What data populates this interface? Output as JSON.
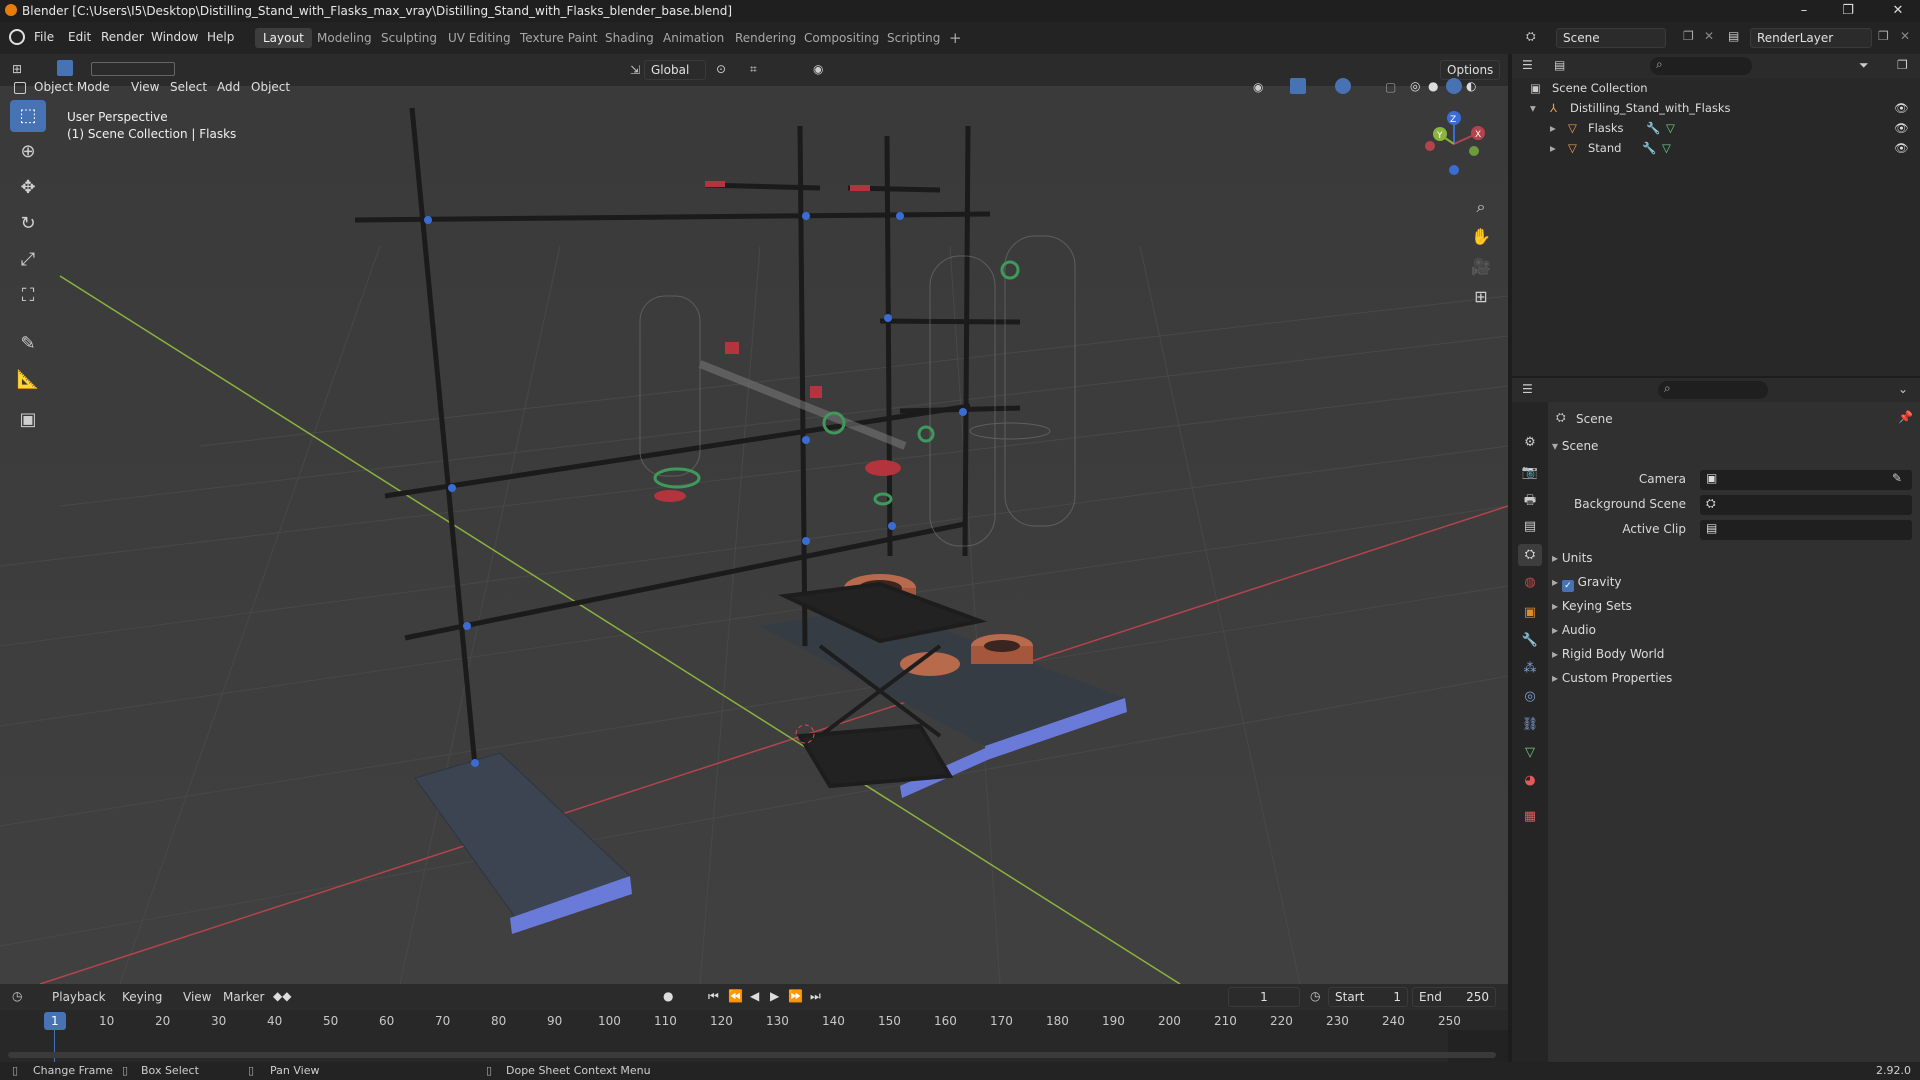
{
  "window": {
    "title": "Blender [C:\\Users\\I5\\Desktop\\Distilling_Stand_with_Flasks_max_vray\\Distilling_Stand_with_Flasks_blender_base.blend]",
    "minimize": "–",
    "maximize": "❐",
    "close": "✕"
  },
  "menus": [
    "File",
    "Edit",
    "Render",
    "Window",
    "Help"
  ],
  "workspaces": [
    {
      "label": "Layout",
      "active": true
    },
    {
      "label": "Modeling"
    },
    {
      "label": "Sculpting"
    },
    {
      "label": "UV Editing"
    },
    {
      "label": "Texture Paint"
    },
    {
      "label": "Shading"
    },
    {
      "label": "Animation"
    },
    {
      "label": "Rendering"
    },
    {
      "label": "Compositing"
    },
    {
      "label": "Scripting"
    }
  ],
  "add_workspace": "+",
  "scene_selector": {
    "value": "Scene"
  },
  "renderlayer_selector": {
    "value": "RenderLayer"
  },
  "viewport_header": {
    "mode": "Object Mode",
    "menus": [
      "View",
      "Select",
      "Add",
      "Object"
    ],
    "transform_orientation": "Global",
    "options": "Options"
  },
  "viewport_overlay": {
    "perspective": "User Perspective",
    "collection": "(1) Scene Collection | Flasks"
  },
  "gizmo": {
    "x": "X",
    "y": "Y",
    "z": "Z"
  },
  "outliner": {
    "root": "Scene Collection",
    "items": [
      {
        "label": "Distilling_Stand_with_Flasks"
      },
      {
        "label": "Flasks"
      },
      {
        "label": "Stand"
      }
    ]
  },
  "properties": {
    "context": "Scene",
    "section": "Scene",
    "camera_label": "Camera",
    "background_scene_label": "Background Scene",
    "active_clip_label": "Active Clip",
    "panels": [
      "Units",
      "Gravity",
      "Keying Sets",
      "Audio",
      "Rigid Body World",
      "Custom Properties"
    ],
    "gravity_checked": true
  },
  "timeline": {
    "menus": [
      "Playback",
      "Keying",
      "View",
      "Marker"
    ],
    "current_frame": "1",
    "start_label": "Start",
    "start": "1",
    "end_label": "End",
    "end": "250",
    "ticks": [
      "1",
      "10",
      "20",
      "30",
      "40",
      "50",
      "60",
      "70",
      "80",
      "90",
      "100",
      "110",
      "120",
      "130",
      "140",
      "150",
      "160",
      "170",
      "180",
      "190",
      "200",
      "210",
      "220",
      "230",
      "240",
      "250"
    ]
  },
  "statusbar": {
    "change_frame": "Change Frame",
    "box_select": "Box Select",
    "pan_view": "Pan View",
    "context_menu": "Dope Sheet Context Menu",
    "version": "2.92.0"
  },
  "colors": {
    "accent": "#4772b3",
    "x_axis": "#b5434c",
    "y_axis": "#8ab43c",
    "grid": "#484848"
  }
}
